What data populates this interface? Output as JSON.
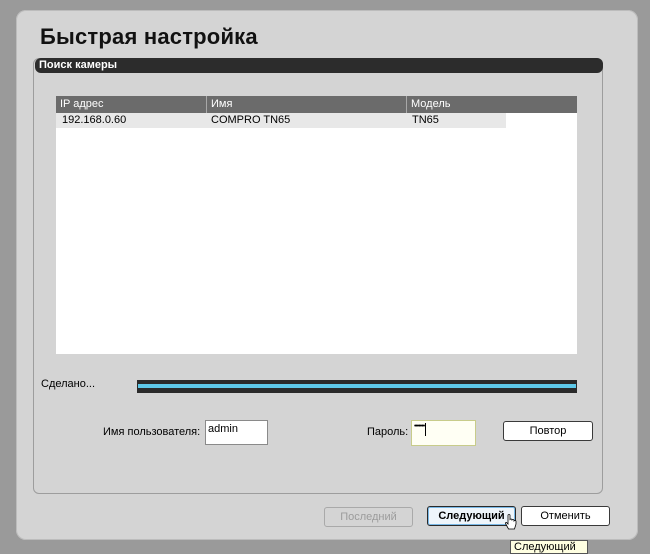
{
  "dialog": {
    "title": "Быстрая настройка",
    "section_header": "Поиск камеры"
  },
  "table": {
    "columns": [
      "IP адрес",
      "Имя",
      "Модель"
    ],
    "rows": [
      {
        "ip": "192.168.0.60",
        "name": "COMPRO TN65",
        "model": "TN65"
      }
    ]
  },
  "progress": {
    "label": "Сделано...",
    "fraction": 1.0,
    "color": "#5ec8e8"
  },
  "credentials": {
    "username_label": "Имя пользователя:",
    "username_value": "admin",
    "password_label": "Пароль:",
    "password_masked": "•••••••"
  },
  "buttons": {
    "retry": "Повтор",
    "previous": "Последний",
    "next": "Следующий",
    "cancel": "Отменить"
  },
  "tooltip": "Следующий"
}
